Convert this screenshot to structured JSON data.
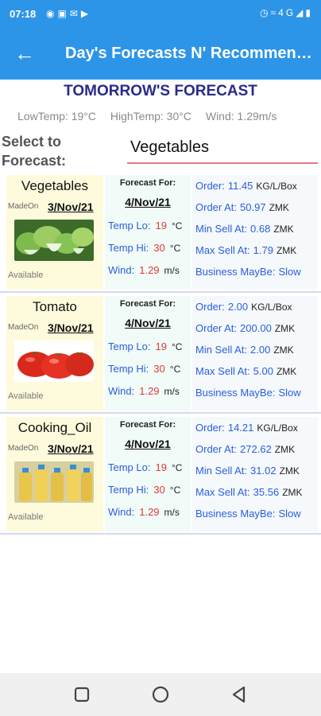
{
  "status_bar": {
    "time": "07:18",
    "left_icons": [
      "messenger-icon",
      "facebook-icon",
      "gmail-icon",
      "youtube-icon"
    ],
    "right_icons": [
      "alarm-icon",
      "wifi-icon",
      "signal-icon",
      "battery-icon"
    ],
    "network": "4G"
  },
  "app_bar": {
    "back_icon": "arrow-left-icon",
    "title": "Day's Forecasts N' Recommendations"
  },
  "forecast": {
    "title": "TOMORROW'S FORECAST",
    "low_temp": "LowTemp: 19°C",
    "high_temp": "HighTemp: 30°C",
    "wind": "Wind: 1.29m/s"
  },
  "selector": {
    "label": "Select to Forecast:",
    "value": "Vegetables"
  },
  "labels": {
    "made_on": "MadeOn",
    "available": "Available",
    "forecast_for": "Forecast For:",
    "temp_lo": "Temp Lo:",
    "temp_hi": "Temp Hi:",
    "wind": "Wind:",
    "order": "Order:",
    "order_at": "Order At:",
    "min_sell": "Min Sell At:",
    "max_sell": "Max Sell At:",
    "business": "Business MayBe:",
    "unit_c": "°C",
    "unit_ms": "m/s",
    "unit_order": "KG/L/Box",
    "unit_zmk": "ZMK"
  },
  "items": [
    {
      "name": "Vegetables",
      "made_on": "3/Nov/21",
      "status": "Available",
      "image_icon": "leafy-greens-photo",
      "forecast_date": "4/Nov/21",
      "temp_lo": "19",
      "temp_hi": "30",
      "wind": "1.29",
      "order": "11.45",
      "order_at": "50.97",
      "min_sell": "0.68",
      "max_sell": "1.79",
      "business": "Slow"
    },
    {
      "name": "Tomato",
      "made_on": "3/Nov/21",
      "status": "Available",
      "image_icon": "tomatoes-photo",
      "forecast_date": "4/Nov/21",
      "temp_lo": "19",
      "temp_hi": "30",
      "wind": "1.29",
      "order": "2.00",
      "order_at": "200.00",
      "min_sell": "2.00",
      "max_sell": "5.00",
      "business": "Slow"
    },
    {
      "name": "Cooking_Oil",
      "made_on": "3/Nov/21",
      "status": "Available",
      "image_icon": "oil-bottles-photo",
      "forecast_date": "4/Nov/21",
      "temp_lo": "19",
      "temp_hi": "30",
      "wind": "1.29",
      "order": "14.21",
      "order_at": "272.62",
      "min_sell": "31.02",
      "max_sell": "35.56",
      "business": "Slow"
    }
  ],
  "nav": {
    "recent_icon": "square-recents-icon",
    "home_icon": "circle-home-icon",
    "back_icon": "triangle-back-icon"
  },
  "colors": {
    "primary": "#2d95e8",
    "title_text": "#2a2a8c",
    "value_red": "#e03a3a",
    "label_blue": "#2a5ee0"
  }
}
